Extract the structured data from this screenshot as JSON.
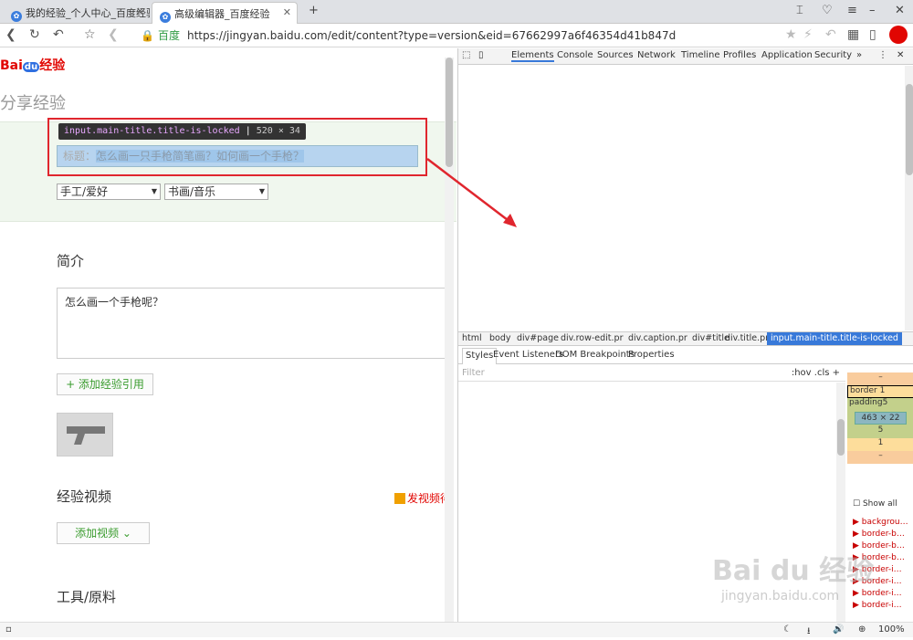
{
  "tabs": [
    {
      "title": "我的经验_个人中心_百度经验"
    },
    {
      "title": "高级编辑器_百度经验"
    }
  ],
  "address": {
    "site": "百度",
    "url": "https://jingyan.baidu.com/edit/content?type=version&eid=67662997a6f46354d41b847d"
  },
  "page": {
    "logo_bai": "Bai",
    "logo_du": "du",
    "logo_jy": "经验",
    "heading": "分享经验",
    "tooltip_tag": "input",
    "tooltip_cls": ".main-title.title-is-locked",
    "tooltip_size": "520 × 34",
    "title_label": "标题：",
    "title_value": "怎么画一只手枪简笔画？如何画一个手枪？",
    "category1": "手工/爱好",
    "category2": "书画/音乐",
    "intro_heading": "简介",
    "intro_text": "怎么画一个手枪呢？",
    "add_ref": "+ 添加经验引用",
    "video_heading": "经验视频",
    "video_link": "发视频得",
    "add_video": "添加视频 ⌄",
    "tools_heading": "工具/原料"
  },
  "devtools": {
    "tabs": [
      "Elements",
      "Console",
      "Sources",
      "Network",
      "Timeline",
      "Profiles",
      "Application",
      "Security"
    ],
    "more": "»",
    "crumbs": [
      "html",
      "body",
      "div#page",
      "div.row-edit.pr",
      "div.caption.pr",
      "div#title",
      "div.title.pr",
      "input.main-title.title-is-locked"
    ],
    "styles_tabs": [
      "Styles",
      "Event Listeners",
      "DOM Breakpoints",
      "Properties"
    ],
    "filter": "Filter",
    "filter_right": ":hov  .cls  +",
    "box": {
      "minus1": "–",
      "border": "border  1",
      "padding": "padding5",
      "content": "463 × 22",
      "five": "5",
      "one": "1",
      "minus2": "–"
    },
    "show_all": "Show all",
    "computed": [
      "▶ backgrou…",
      "▶ border-b…",
      "▶ border-b…",
      "▶ border-b…",
      "▶ border-i…",
      "▶ border-i…",
      "▶ border-i…",
      "▶ border-i…"
    ]
  },
  "status": {
    "zoom": "100%"
  },
  "watermark": {
    "big": "Bai du 经验",
    "small": "jingyan.baidu.com"
  }
}
